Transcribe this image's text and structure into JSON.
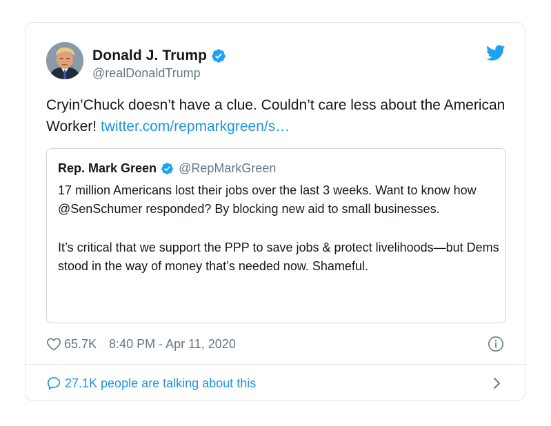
{
  "tweet": {
    "author": {
      "display_name": "Donald J. Trump",
      "handle": "@realDonaldTrump"
    },
    "text_plain": "Cryin’Chuck doesn’t have a clue. Couldn’t care less about the American Worker! ",
    "link_text": "twitter.com/repmarkgreen/s…",
    "quoted": {
      "display_name": "Rep. Mark Green",
      "handle": "@RepMarkGreen",
      "paragraph_1": "17 million Americans lost their jobs over the last 3 weeks. Want to know how @SenSchumer responded? By blocking new aid to small businesses.",
      "paragraph_2": "It’s critical that we support the PPP to save jobs & protect livelihoods—but Dems stood in the way of money that’s needed now. Shameful."
    },
    "likes": "65.7K",
    "timestamp": "8:40 PM - Apr 11, 2020",
    "conversation": "27.1K people are talking about this"
  },
  "icons": {
    "verified": "verified-badge-icon",
    "twitter": "twitter-bird-icon",
    "like": "heart-icon",
    "info": "info-icon",
    "conversation": "speech-bubble-icon",
    "chevron": "chevron-right-icon"
  },
  "colors": {
    "link": "#1b95e0",
    "text": "#14171a",
    "secondary": "#657786",
    "border": "#e1e8ed"
  }
}
